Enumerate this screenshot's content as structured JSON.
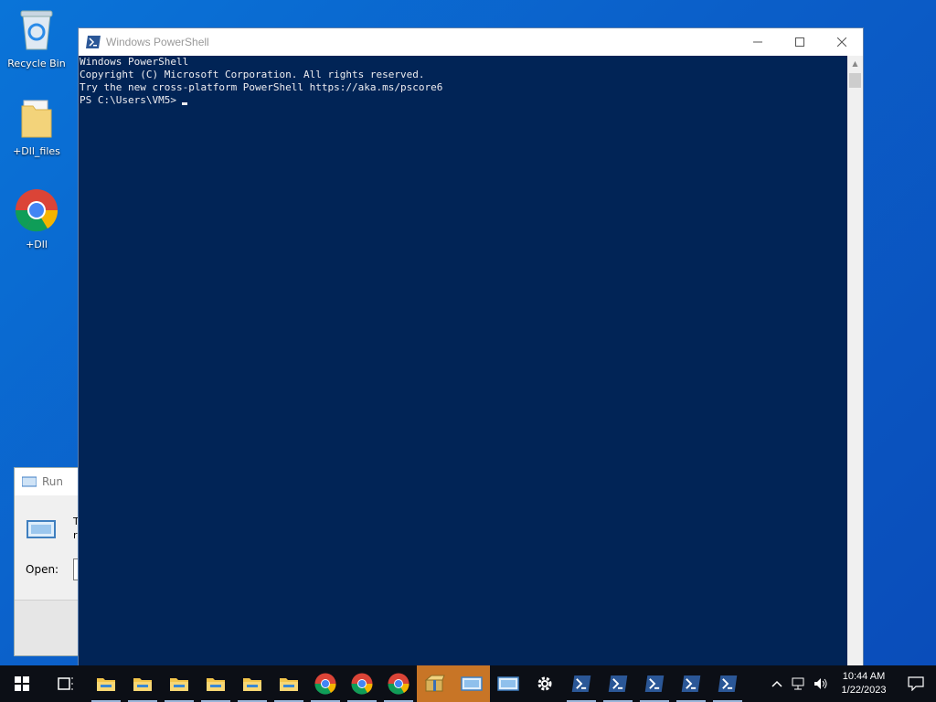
{
  "desktop": {
    "icons": [
      {
        "label": "Recycle Bin"
      },
      {
        "label": "+Dll_files"
      },
      {
        "label": "+Dll"
      }
    ]
  },
  "run_dialog": {
    "title": "Run",
    "open_label": "Open:",
    "partial_text_1": "T",
    "partial_text_2": "r"
  },
  "powershell": {
    "title": "Windows PowerShell",
    "lines": [
      "Windows PowerShell",
      "Copyright (C) Microsoft Corporation. All rights reserved.",
      "",
      "Try the new cross-platform PowerShell https://aka.ms/pscore6",
      ""
    ],
    "prompt": "PS C:\\Users\\VM5>",
    "colors": {
      "background": "#012456",
      "text": "#eeedf0"
    }
  },
  "taskbar": {
    "clock": {
      "time": "10:44 AM",
      "date": "1/22/2023"
    },
    "items": [
      {
        "name": "file-explorer"
      },
      {
        "name": "file-explorer"
      },
      {
        "name": "file-explorer"
      },
      {
        "name": "file-explorer"
      },
      {
        "name": "file-explorer"
      },
      {
        "name": "file-explorer"
      },
      {
        "name": "chrome"
      },
      {
        "name": "chrome"
      },
      {
        "name": "chrome"
      },
      {
        "name": "archive"
      },
      {
        "name": "run"
      },
      {
        "name": "run"
      },
      {
        "name": "settings"
      },
      {
        "name": "powershell"
      },
      {
        "name": "powershell"
      },
      {
        "name": "powershell"
      },
      {
        "name": "powershell"
      },
      {
        "name": "powershell"
      }
    ]
  }
}
